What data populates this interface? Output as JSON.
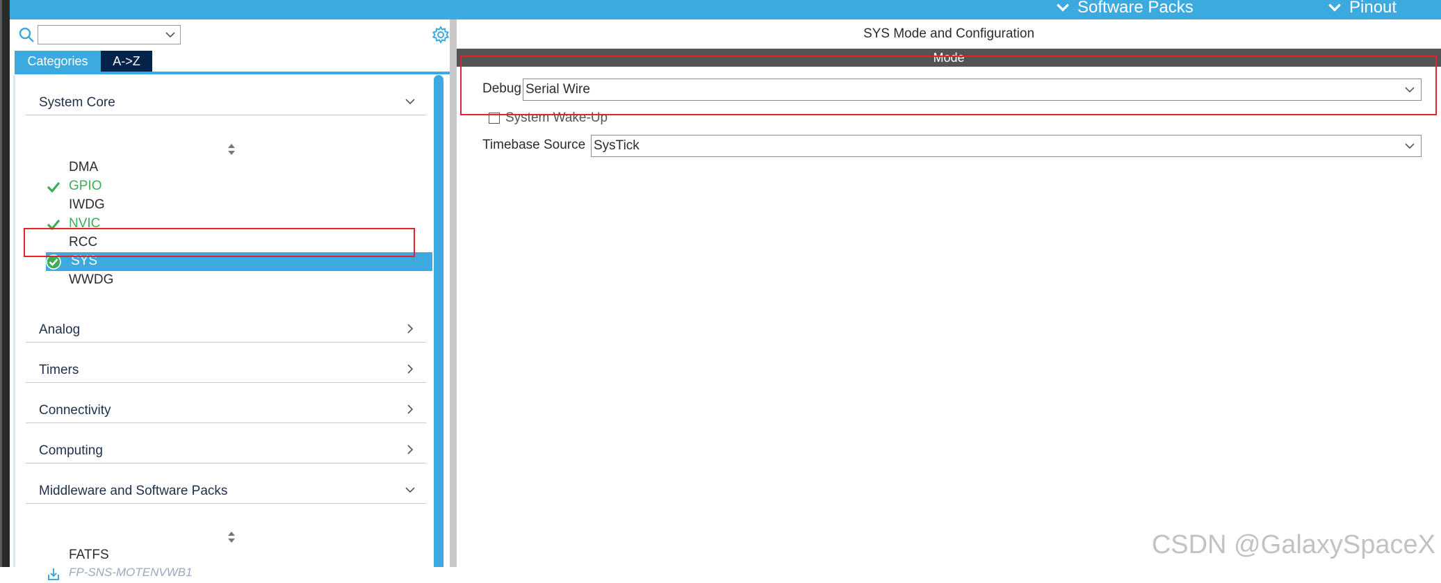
{
  "topbar": {
    "software_packs_label": "Software Packs",
    "pinout_label": "Pinout",
    "color": "#3caadf"
  },
  "left_panel": {
    "search": {
      "value": ""
    },
    "tabs": [
      {
        "label": "Categories",
        "active": true
      },
      {
        "label": "A->Z",
        "active": false
      }
    ],
    "categories": [
      {
        "label": "System Core",
        "expanded": true,
        "items": [
          {
            "label": "DMA",
            "status": "none"
          },
          {
            "label": "GPIO",
            "status": "configured"
          },
          {
            "label": "IWDG",
            "status": "none"
          },
          {
            "label": "NVIC",
            "status": "configured"
          },
          {
            "label": "RCC",
            "status": "none"
          },
          {
            "label": "SYS",
            "status": "selected-configured"
          },
          {
            "label": "WWDG",
            "status": "none"
          }
        ]
      },
      {
        "label": "Analog",
        "expanded": false
      },
      {
        "label": "Timers",
        "expanded": false
      },
      {
        "label": "Connectivity",
        "expanded": false
      },
      {
        "label": "Computing",
        "expanded": false
      },
      {
        "label": "Middleware and Software Packs",
        "expanded": true,
        "items": [
          {
            "label": "FATFS",
            "status": "none"
          },
          {
            "label": "FP-SNS-MOTENVWB1",
            "status": "download"
          }
        ]
      }
    ]
  },
  "right_panel": {
    "title": "SYS Mode and Configuration",
    "mode_header": "Mode",
    "debug": {
      "label": "Debug",
      "value": "Serial Wire"
    },
    "system_wakeup": {
      "label": "System Wake-Up",
      "checked": false
    },
    "timebase": {
      "label": "Timebase Source",
      "value": "SysTick"
    }
  },
  "watermark": "CSDN @GalaxySpaceX",
  "colors": {
    "accent": "#3caadf",
    "configured_green": "#3aae5a",
    "tab_dark": "#03234b",
    "mode_bar": "#545454",
    "highlight_red": "#e0242a"
  }
}
